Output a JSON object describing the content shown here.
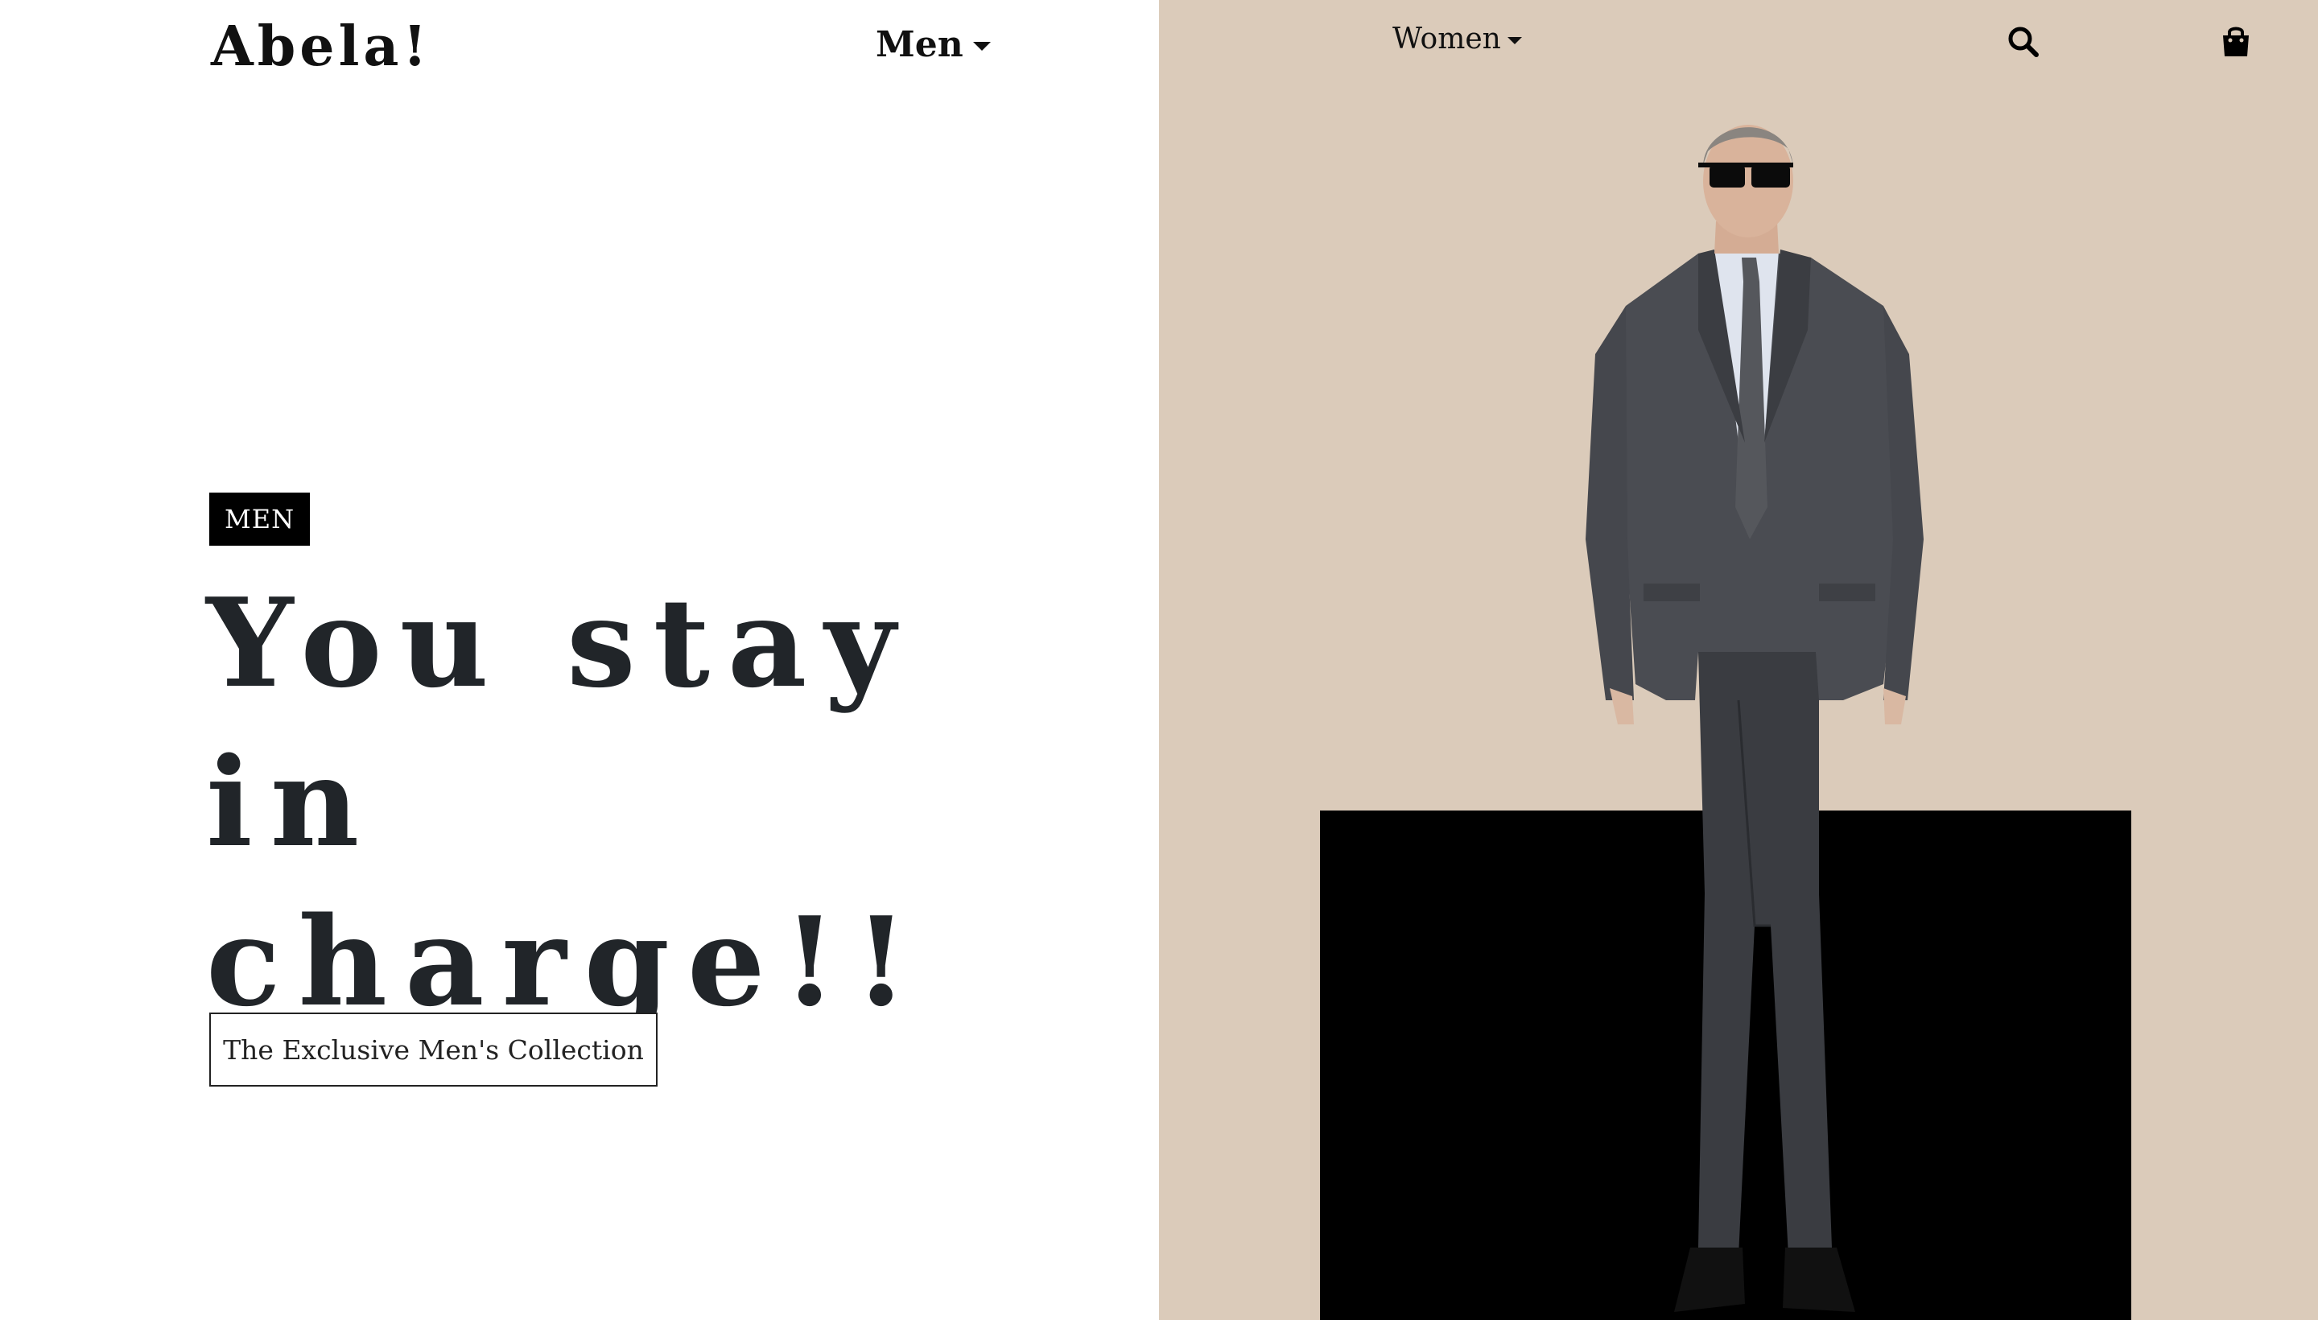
{
  "brand": {
    "logo_text": "Abela!"
  },
  "nav": {
    "men_label": "Men",
    "women_label": "Women",
    "icons": [
      "chevron-down-icon",
      "search-icon",
      "shopping-bag-icon"
    ]
  },
  "hero": {
    "badge": "MEN",
    "headline_line1": "You stay in",
    "headline_line2": "charge!!",
    "cta_label": "The Exclusive Men's Collection"
  },
  "colors": {
    "right_panel_bg": "#dbcbba",
    "block": "#000000",
    "text": "#212529",
    "badge_bg": "#000000"
  }
}
